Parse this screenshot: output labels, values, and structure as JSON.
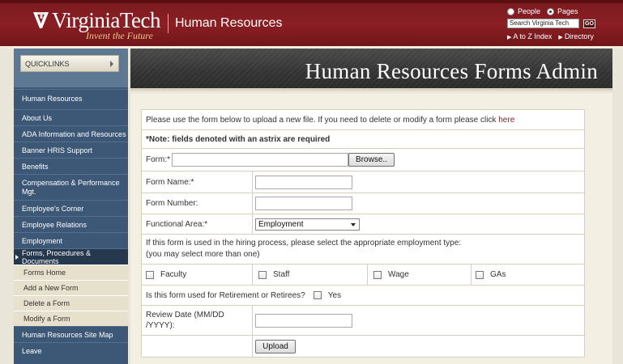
{
  "header": {
    "logo_text": "VirginiaTech",
    "tagline": "Invent the Future",
    "section": "Human Resources",
    "search": {
      "radio_people": "People",
      "radio_pages": "Pages",
      "input_value": "Search Virginia Tech",
      "go_label": "GO"
    },
    "links": [
      "A to Z Index",
      "Directory"
    ]
  },
  "sidebar": {
    "quicklinks": "QUICKLINKS",
    "items": [
      {
        "label": "Human Resources"
      },
      {
        "label": "About Us"
      },
      {
        "label": "ADA Information and Resources"
      },
      {
        "label": "Banner HRIS Support"
      },
      {
        "label": "Benefits"
      },
      {
        "label": "Compensation & Performance Mgt."
      },
      {
        "label": "Employee's Corner"
      },
      {
        "label": "Employee Relations"
      },
      {
        "label": "Employment"
      },
      {
        "label": "Forms, Procedures & Documents"
      },
      {
        "label": "Human Resources Site Map"
      },
      {
        "label": "Leave"
      }
    ],
    "sub_items": [
      {
        "label": "Forms Home"
      },
      {
        "label": "Add a New Form"
      },
      {
        "label": "Delete a Form"
      },
      {
        "label": "Modify a Form"
      }
    ]
  },
  "main": {
    "title": "Human Resources Forms Admin",
    "intro": "Please use the form below to upload a new file. If you need to delete or modify a form please click",
    "intro_link": "here",
    "note": "*Note: fields denoted with an astrix are required",
    "form_label": "Form:*",
    "browse_label": "Browse..",
    "form_name_label": "Form Name:*",
    "form_number_label": "Form Number:",
    "functional_area_label": "Functional Area:*",
    "functional_area_value": "Employment",
    "hiring_text_1": "If this form is used in the hiring process, please select the appropriate employment type:",
    "hiring_text_2": "(you may select more than one)",
    "types": [
      "Faculty",
      "Staff",
      "Wage",
      "GAs"
    ],
    "retirement_question": "Is this form used for Retirement or Retirees?",
    "retirement_yes": "Yes",
    "review_date_label_1": "Review Date (MM/DD",
    "review_date_label_2": "/YYYY):",
    "upload_label": "Upload"
  },
  "colors": {
    "header_maroon": "#7a1a1f",
    "sidebar_blue": "#3c5876",
    "sub_nav_tan": "#e6e0cc",
    "link_maroon": "#8a1f24"
  }
}
